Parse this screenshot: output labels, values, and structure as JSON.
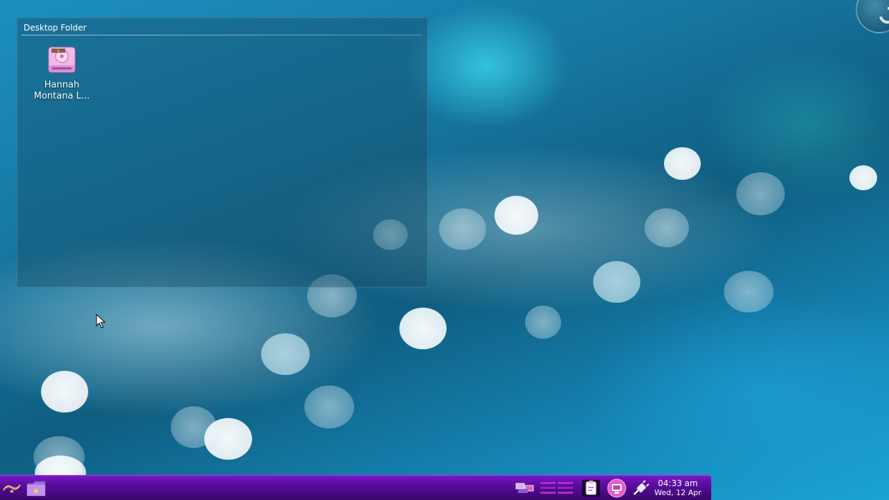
{
  "desktop_folder": {
    "title": "Desktop Folder",
    "items": [
      {
        "label": "Hannah\nMontana L...",
        "icon": "hard-drive-icon"
      }
    ]
  },
  "taskbar": {
    "launcher_icon": "hannah-montana-launcher-icon",
    "folder_icon": "star-folder-icon",
    "tray_icons": [
      "pager-icon",
      "activity-bars-icon",
      "clipboard-icon",
      "network-monitor-icon",
      "battery-plug-icon"
    ],
    "clock": {
      "time": "04:33 am",
      "date": "Wed, 12 Apr"
    }
  },
  "colors": {
    "taskbar_accent": "#6a12b4",
    "desktop_background": "#1778a3"
  }
}
